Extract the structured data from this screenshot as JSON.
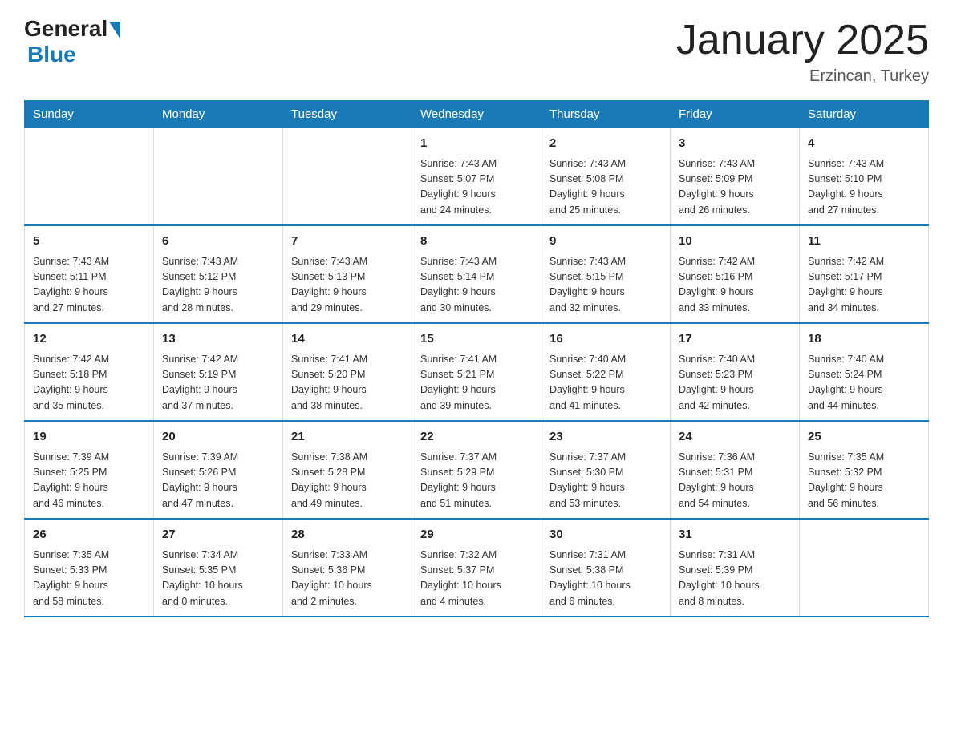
{
  "logo": {
    "general": "General",
    "blue": "Blue"
  },
  "title": "January 2025",
  "subtitle": "Erzincan, Turkey",
  "weekdays": [
    "Sunday",
    "Monday",
    "Tuesday",
    "Wednesday",
    "Thursday",
    "Friday",
    "Saturday"
  ],
  "weeks": [
    [
      {
        "day": "",
        "info": ""
      },
      {
        "day": "",
        "info": ""
      },
      {
        "day": "",
        "info": ""
      },
      {
        "day": "1",
        "info": "Sunrise: 7:43 AM\nSunset: 5:07 PM\nDaylight: 9 hours\nand 24 minutes."
      },
      {
        "day": "2",
        "info": "Sunrise: 7:43 AM\nSunset: 5:08 PM\nDaylight: 9 hours\nand 25 minutes."
      },
      {
        "day": "3",
        "info": "Sunrise: 7:43 AM\nSunset: 5:09 PM\nDaylight: 9 hours\nand 26 minutes."
      },
      {
        "day": "4",
        "info": "Sunrise: 7:43 AM\nSunset: 5:10 PM\nDaylight: 9 hours\nand 27 minutes."
      }
    ],
    [
      {
        "day": "5",
        "info": "Sunrise: 7:43 AM\nSunset: 5:11 PM\nDaylight: 9 hours\nand 27 minutes."
      },
      {
        "day": "6",
        "info": "Sunrise: 7:43 AM\nSunset: 5:12 PM\nDaylight: 9 hours\nand 28 minutes."
      },
      {
        "day": "7",
        "info": "Sunrise: 7:43 AM\nSunset: 5:13 PM\nDaylight: 9 hours\nand 29 minutes."
      },
      {
        "day": "8",
        "info": "Sunrise: 7:43 AM\nSunset: 5:14 PM\nDaylight: 9 hours\nand 30 minutes."
      },
      {
        "day": "9",
        "info": "Sunrise: 7:43 AM\nSunset: 5:15 PM\nDaylight: 9 hours\nand 32 minutes."
      },
      {
        "day": "10",
        "info": "Sunrise: 7:42 AM\nSunset: 5:16 PM\nDaylight: 9 hours\nand 33 minutes."
      },
      {
        "day": "11",
        "info": "Sunrise: 7:42 AM\nSunset: 5:17 PM\nDaylight: 9 hours\nand 34 minutes."
      }
    ],
    [
      {
        "day": "12",
        "info": "Sunrise: 7:42 AM\nSunset: 5:18 PM\nDaylight: 9 hours\nand 35 minutes."
      },
      {
        "day": "13",
        "info": "Sunrise: 7:42 AM\nSunset: 5:19 PM\nDaylight: 9 hours\nand 37 minutes."
      },
      {
        "day": "14",
        "info": "Sunrise: 7:41 AM\nSunset: 5:20 PM\nDaylight: 9 hours\nand 38 minutes."
      },
      {
        "day": "15",
        "info": "Sunrise: 7:41 AM\nSunset: 5:21 PM\nDaylight: 9 hours\nand 39 minutes."
      },
      {
        "day": "16",
        "info": "Sunrise: 7:40 AM\nSunset: 5:22 PM\nDaylight: 9 hours\nand 41 minutes."
      },
      {
        "day": "17",
        "info": "Sunrise: 7:40 AM\nSunset: 5:23 PM\nDaylight: 9 hours\nand 42 minutes."
      },
      {
        "day": "18",
        "info": "Sunrise: 7:40 AM\nSunset: 5:24 PM\nDaylight: 9 hours\nand 44 minutes."
      }
    ],
    [
      {
        "day": "19",
        "info": "Sunrise: 7:39 AM\nSunset: 5:25 PM\nDaylight: 9 hours\nand 46 minutes."
      },
      {
        "day": "20",
        "info": "Sunrise: 7:39 AM\nSunset: 5:26 PM\nDaylight: 9 hours\nand 47 minutes."
      },
      {
        "day": "21",
        "info": "Sunrise: 7:38 AM\nSunset: 5:28 PM\nDaylight: 9 hours\nand 49 minutes."
      },
      {
        "day": "22",
        "info": "Sunrise: 7:37 AM\nSunset: 5:29 PM\nDaylight: 9 hours\nand 51 minutes."
      },
      {
        "day": "23",
        "info": "Sunrise: 7:37 AM\nSunset: 5:30 PM\nDaylight: 9 hours\nand 53 minutes."
      },
      {
        "day": "24",
        "info": "Sunrise: 7:36 AM\nSunset: 5:31 PM\nDaylight: 9 hours\nand 54 minutes."
      },
      {
        "day": "25",
        "info": "Sunrise: 7:35 AM\nSunset: 5:32 PM\nDaylight: 9 hours\nand 56 minutes."
      }
    ],
    [
      {
        "day": "26",
        "info": "Sunrise: 7:35 AM\nSunset: 5:33 PM\nDaylight: 9 hours\nand 58 minutes."
      },
      {
        "day": "27",
        "info": "Sunrise: 7:34 AM\nSunset: 5:35 PM\nDaylight: 10 hours\nand 0 minutes."
      },
      {
        "day": "28",
        "info": "Sunrise: 7:33 AM\nSunset: 5:36 PM\nDaylight: 10 hours\nand 2 minutes."
      },
      {
        "day": "29",
        "info": "Sunrise: 7:32 AM\nSunset: 5:37 PM\nDaylight: 10 hours\nand 4 minutes."
      },
      {
        "day": "30",
        "info": "Sunrise: 7:31 AM\nSunset: 5:38 PM\nDaylight: 10 hours\nand 6 minutes."
      },
      {
        "day": "31",
        "info": "Sunrise: 7:31 AM\nSunset: 5:39 PM\nDaylight: 10 hours\nand 8 minutes."
      },
      {
        "day": "",
        "info": ""
      }
    ]
  ]
}
